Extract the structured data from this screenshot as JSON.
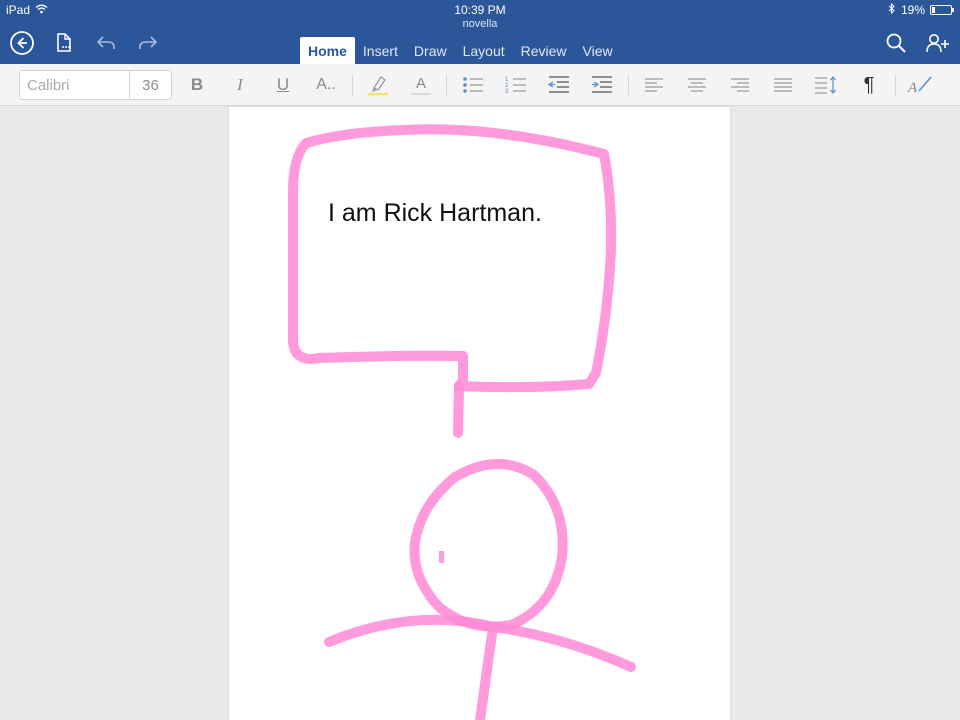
{
  "status_bar": {
    "device": "iPad",
    "time": "10:39 PM",
    "battery": "19%",
    "battery_level": 0.19
  },
  "header": {
    "doc_title": "novella",
    "tabs": [
      {
        "label": "Home",
        "active": true
      },
      {
        "label": "Insert",
        "active": false
      },
      {
        "label": "Draw",
        "active": false
      },
      {
        "label": "Layout",
        "active": false
      },
      {
        "label": "Review",
        "active": false
      },
      {
        "label": "View",
        "active": false
      }
    ],
    "icons": [
      "back-icon",
      "file-icon",
      "undo-icon",
      "redo-icon",
      "search-icon",
      "share-user-icon"
    ]
  },
  "ribbon": {
    "font_name": "Calibri",
    "font_size": "36",
    "bold": "B",
    "italic": "I",
    "underline": "U",
    "text_effects": "A..",
    "font_color": "A",
    "paragraph_mark": "¶"
  },
  "document": {
    "text": "I am Rick Hartman."
  },
  "colors": {
    "brand": "#2b579a",
    "ink": "#ff8ad6"
  }
}
